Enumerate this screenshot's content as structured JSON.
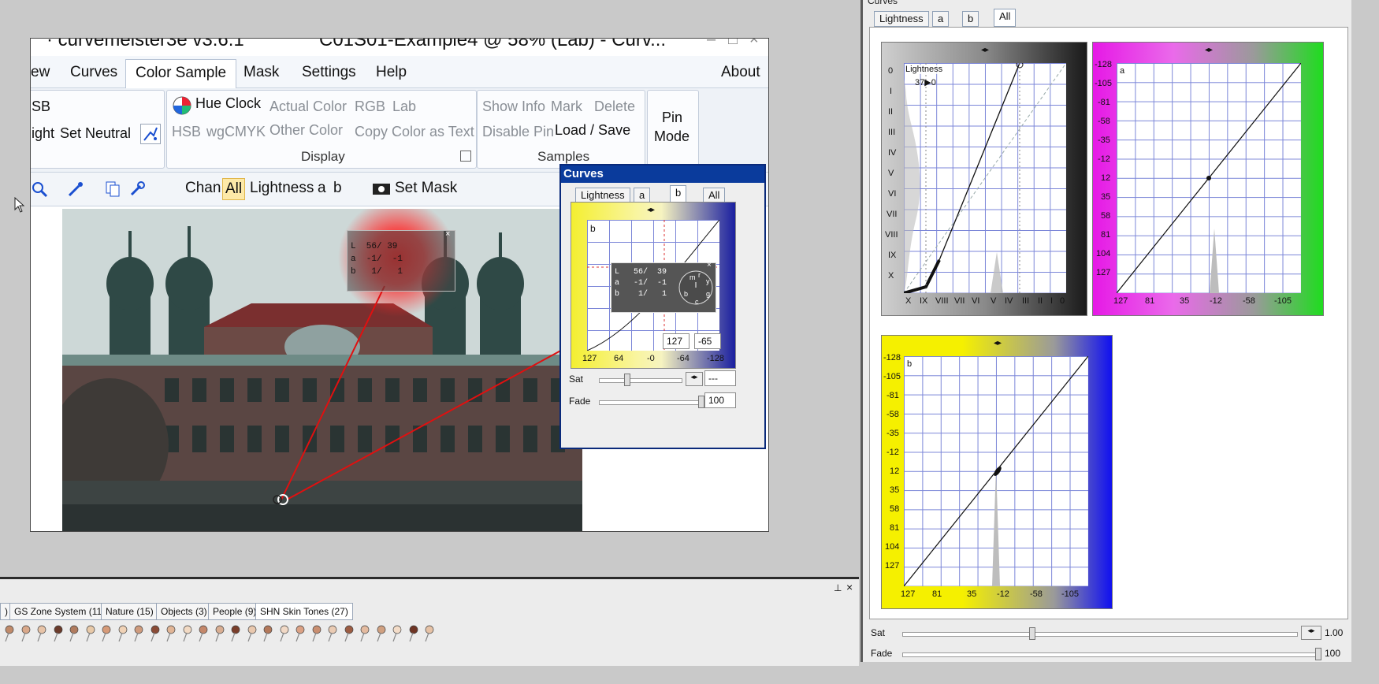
{
  "main_window": {
    "title_app": "· curvemeister3e v3.6.1",
    "title_doc": "C01S01-Example4 @ 58% (Lab) - Curv...",
    "menu": [
      "ew",
      "Curves",
      "Color Sample",
      "Mask",
      "Settings",
      "Help"
    ],
    "about": "About",
    "ribbon": {
      "left_top": "SB",
      "left_bottom": "ight",
      "set_neutral": "Set Neutral",
      "hue_clock": "Hue Clock",
      "actual_color": "Actual Color",
      "rgb": "RGB",
      "lab": "Lab",
      "hsb": "HSB",
      "wgcmyk": "wgCMYK",
      "other_color": "Other Color",
      "copy_color_as_text": "Copy Color as Text",
      "display_group": "Display",
      "show_info": "Show Info",
      "mark": "Mark",
      "delete": "Delete",
      "disable_pin": "Disable Pin",
      "load_save": "Load / Save",
      "samples_group": "Samples",
      "pin_mode_1": "Pin",
      "pin_mode_2": "Mode"
    },
    "toolbar": {
      "chan_label": "Chan:",
      "chan_all": "All",
      "chan_lightness": "Lightness",
      "chan_a": "a",
      "chan_b": "b",
      "set_mask": "Set Mask"
    },
    "sample_popup": {
      "rows": [
        "L  56/ 39",
        "a  -1/  -1",
        "b   1/   1"
      ]
    }
  },
  "curves_panel": {
    "title": "Curves",
    "tabs": [
      "Lightness",
      "a",
      "b",
      "All"
    ],
    "channel_label": "b",
    "x_ticks": [
      "127",
      "64",
      "-0",
      "-64",
      "-128"
    ],
    "readout": {
      "in": "127",
      "out": "-65"
    },
    "sample_rows": [
      "L   56/  39",
      "a   -1/  -1",
      "b    1/   1"
    ],
    "clock_letters": [
      "m",
      "r",
      "y",
      "g",
      "c",
      "b"
    ],
    "sat_label": "Sat",
    "sat_value": "---",
    "fade_label": "Fade",
    "fade_value": "100",
    "sat_level": 0.35,
    "fade_level": 1.0
  },
  "right_window": {
    "title": "Curves",
    "tabs": [
      "Lightness",
      "a",
      "b",
      "All"
    ],
    "lightness": {
      "label": "Lightness",
      "readout": "37▶0",
      "y_ticks": [
        "0",
        "I",
        "II",
        "III",
        "IV",
        "V",
        "VI",
        "VII",
        "VIII",
        "IX",
        "X"
      ],
      "x_ticks": [
        "X",
        "IX",
        "VIII",
        "VII",
        "VI",
        "V",
        "IV",
        "III",
        "II",
        "I",
        "0"
      ]
    },
    "a": {
      "label": "a",
      "y_ticks": [
        "-128",
        "-105",
        "-81",
        "-58",
        "-35",
        "-12",
        "12",
        "35",
        "58",
        "81",
        "104",
        "127"
      ],
      "x_ticks": [
        "127",
        "81",
        "35",
        "-12",
        "-58",
        "-105"
      ]
    },
    "b": {
      "label": "b",
      "y_ticks": [
        "-128",
        "-105",
        "-81",
        "-58",
        "-35",
        "-12",
        "12",
        "35",
        "58",
        "81",
        "104",
        "127"
      ],
      "x_ticks": [
        "127",
        "81",
        "35",
        "-12",
        "-58",
        "-105"
      ]
    },
    "sat_label": "Sat",
    "sat_value": "1.00",
    "fade_label": "Fade",
    "fade_value": "100",
    "sat_level": 0.33,
    "fade_level": 1.0
  },
  "palette": {
    "tabs": [
      ")",
      "GS Zone System (11)",
      "Nature (15)",
      "Objects (3)",
      "People (9)",
      "SHN Skin Tones (27)"
    ],
    "selected_tab": "SHN Skin Tones (27)",
    "pin_colors": [
      "#c08a6a",
      "#d9a88a",
      "#e7c3a7",
      "#6a3a2a",
      "#b07b5e",
      "#e8c9a8",
      "#d69a78",
      "#f0d2b6",
      "#cf9b7d",
      "#8a4b36",
      "#e1b596",
      "#f2dac4",
      "#c4876a",
      "#d9ae92",
      "#7a3e2a",
      "#e9c8ae",
      "#b3785a",
      "#f1d9c6",
      "#dba184",
      "#c98e70",
      "#eacbb3",
      "#9c5c42",
      "#e4bba0",
      "#d0a080",
      "#f3dcc8",
      "#6e3424",
      "#e6c2a6"
    ]
  },
  "colors": {
    "title_blue": "#0a3b9c",
    "grid_blue": "#7b86d8",
    "magenta": "#e619e6",
    "green": "#1fdc1f",
    "yellow": "#f5f000",
    "blue": "#1010f0",
    "sample_red": "#ff1a1a"
  }
}
